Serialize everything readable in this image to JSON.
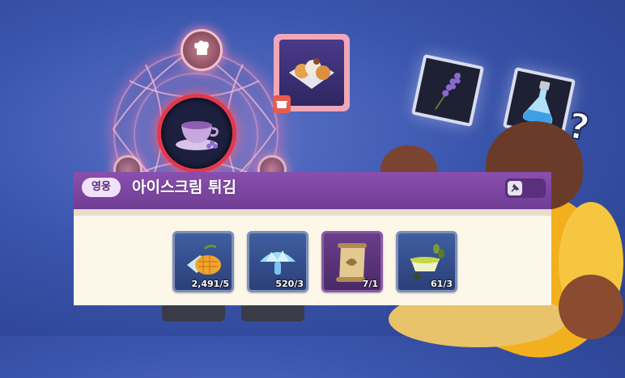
{
  "colors": {
    "background": "#3a55ad",
    "panel_header": "#7a45a0",
    "panel_body": "#fdf7e9",
    "main_node_ring": "#e2384d",
    "uncertain_card_border": "#7d8fb8",
    "rare_card_border": "#8a5aa8"
  },
  "crafting_circle": {
    "top_node_icon": "chef-hat-icon",
    "main_node_icon": "lavender-tea-cup-icon"
  },
  "result_item": {
    "icon": "fried-ice-cream-icon",
    "badge_icon": "cooking-pot-icon"
  },
  "hint_items": [
    {
      "icon": "lavender-icon"
    },
    {
      "icon": "potion-bottle-icon"
    }
  ],
  "question_marks": [
    "?",
    "?"
  ],
  "recipe_panel": {
    "grade": "영웅",
    "title": "아이스크림 튀김",
    "pin_icon": "pin-icon"
  },
  "ingredients": [
    {
      "icon": "mango-ice-icon",
      "quantity": "2,491/5",
      "border": "#7d8fb8"
    },
    {
      "icon": "crystal-mushroom-icon",
      "quantity": "520/3",
      "border": "#7d8fb8"
    },
    {
      "icon": "scroll-recipe-icon",
      "quantity": "7/1",
      "border": "#8a5aa8"
    },
    {
      "icon": "olive-oil-icon",
      "quantity": "61/3",
      "border": "#7d8fb8"
    }
  ]
}
